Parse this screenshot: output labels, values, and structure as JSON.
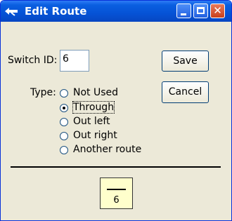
{
  "window": {
    "title": "Edit Route"
  },
  "form": {
    "switch_id_label": "Switch ID:",
    "switch_id_value": "6",
    "type_label": "Type:"
  },
  "buttons": {
    "save": "Save",
    "cancel": "Cancel"
  },
  "type_options": [
    {
      "label": "Not Used",
      "selected": false
    },
    {
      "label": "Through",
      "selected": true
    },
    {
      "label": "Out left",
      "selected": false
    },
    {
      "label": "Out right",
      "selected": false
    },
    {
      "label": "Another route",
      "selected": false
    }
  ],
  "preview": {
    "value": "6"
  },
  "icons": {
    "app": "route-arrow-icon",
    "minimize": "minimize-icon",
    "maximize": "maximize-icon",
    "close": "close-icon"
  },
  "colors": {
    "titlebar": "#0553d6",
    "dialog_bg": "#ece9d8",
    "preview_bg": "#ffffcc",
    "close_button": "#c8401b"
  }
}
